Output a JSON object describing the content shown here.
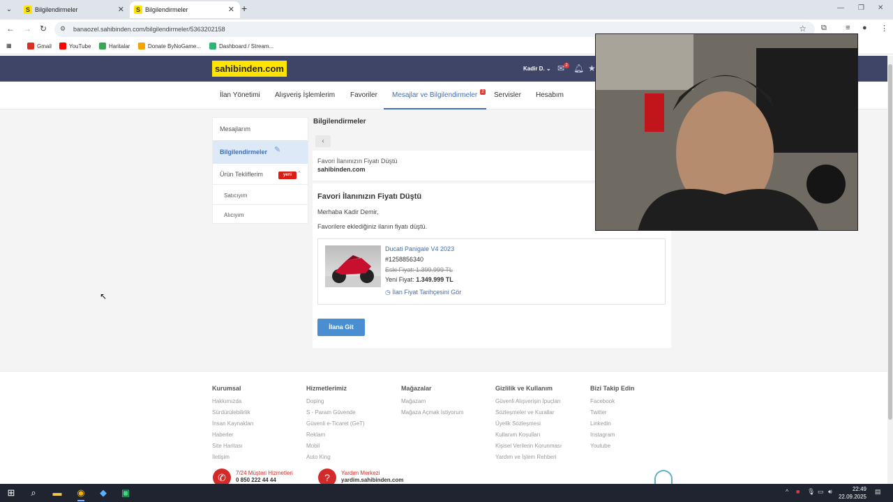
{
  "browser": {
    "tabs": [
      {
        "title": "Bilgilendirmeler",
        "favicon": "S"
      },
      {
        "title": "Bilgilendirmeler",
        "favicon": "S"
      }
    ],
    "url": "banaozel.sahibinden.com/bilgilendirmeler/5363202158",
    "bookmarks": [
      {
        "label": "Gmail",
        "color": "#d93025"
      },
      {
        "label": "YouTube",
        "color": "#ff0000"
      },
      {
        "label": "Haritalar",
        "color": "#34a853"
      },
      {
        "label": "Donate ByNoGame...",
        "color": "#f4a300"
      },
      {
        "label": "Dashboard / Stream...",
        "color": "#2bb673"
      }
    ]
  },
  "site": {
    "logo": "sahibinden.com",
    "user": "Kadir D.",
    "message_badge": "2",
    "nav": [
      {
        "label": "İlan Yönetimi"
      },
      {
        "label": "Alışveriş İşlemlerim"
      },
      {
        "label": "Favoriler"
      },
      {
        "label": "Mesajlar ve Bilgilendirmeler"
      },
      {
        "label": "Servisler"
      },
      {
        "label": "Hesabım"
      }
    ],
    "nav_badge": "2"
  },
  "sidebar": {
    "items": [
      {
        "label": "Mesajlarım"
      },
      {
        "label": "Bilgilendirmeler"
      },
      {
        "label": "Ürün Tekliflerim"
      },
      {
        "label": "Satıcıyım"
      },
      {
        "label": "Alıcıyım"
      }
    ],
    "new_badge": "yeni"
  },
  "main": {
    "title": "Bilgilendirmeler",
    "message_subject": "Favori İlanınızın Fiyatı Düştü",
    "message_from": "sahibinden.com",
    "body_title": "Favori İlanınızın Fiyatı Düştü",
    "greeting": "Merhaba Kadir Demir,",
    "line": "Favorilere eklediğiniz ilanın fiyatı düştü.",
    "listing": {
      "title": "Ducati Panigale V4 2023",
      "id": "#1258856340",
      "old_price": "Eski Fiyat: 1.399.999 TL",
      "new_price_label": "Yeni Fiyat:",
      "new_price": "1.349.999 TL",
      "history_link": "İlan Fiyat Tarihçesini Gör"
    },
    "go_button": "İlana Git"
  },
  "footer": {
    "columns": [
      {
        "title": "Kurumsal",
        "links": [
          "Hakkımızda",
          "Sürdürülebilirlik",
          "İnsan Kaynakları",
          "Haberler",
          "Site Haritası",
          "İletişim"
        ]
      },
      {
        "title": "Hizmetlerimiz",
        "links": [
          "Doping",
          "S - Param Güvende",
          "Güvenli e-Ticaret (GeT)",
          "Reklam",
          "Mobil",
          "Auto King"
        ]
      },
      {
        "title": "Mağazalar",
        "links": [
          "Mağazam",
          "Mağaza Açmak İstiyorum"
        ]
      },
      {
        "title": "Gizlilik ve Kullanım",
        "links": [
          "Güvenli Alışverişin İpuçları",
          "Sözleşmeler ve Kurallar",
          "Üyelik Sözleşmesi",
          "Kullanım Koşulları",
          "Kişisel Verilerin Korunması",
          "Yardım ve İşlem Rehberi"
        ]
      },
      {
        "title": "Bizi Takip Edin",
        "links": [
          "Facebook",
          "Twitter",
          "Linkedin",
          "Instagram",
          "Youtube"
        ]
      }
    ],
    "support": [
      {
        "line1": "7/24 Müşteri Hizmetleri",
        "line2": "0 850 222 44 44"
      },
      {
        "line1": "Yardım Merkezi",
        "line2": "yardim.sahibinden.com"
      }
    ]
  },
  "taskbar": {
    "time": "22:49",
    "date": "22.09.2025"
  },
  "colors": {
    "header_bg": "#3e4566",
    "brand_yellow": "#ffe400",
    "link_blue": "#3f6eb5",
    "button_blue": "#4a8ed2",
    "badge_red": "#d91e18"
  }
}
